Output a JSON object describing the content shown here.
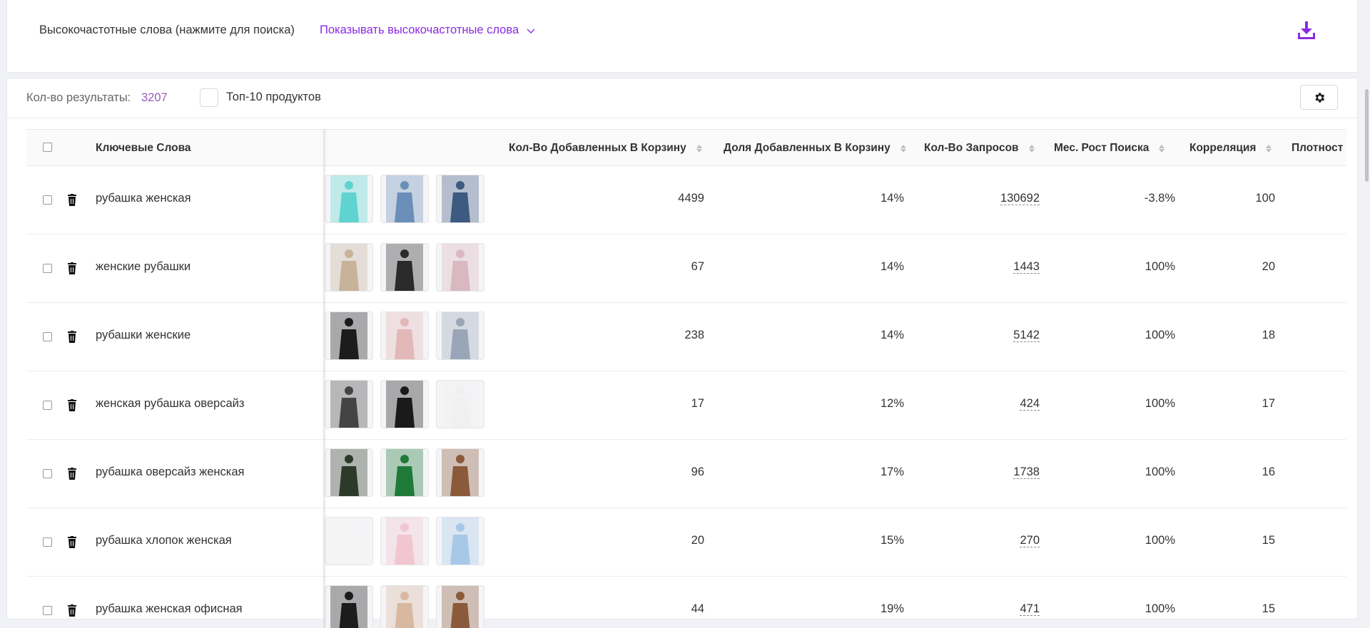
{
  "high_freq": {
    "label": "Высокочастотные слова (нажмите для поиска)",
    "toggle": "Показывать высокочастотные слова",
    "download_icon": "download-icon"
  },
  "results": {
    "count_label": "Кол-во результаты:",
    "count_value": "3207",
    "top10_label": "Топ-10 продуктов",
    "settings_icon": "gear-icon"
  },
  "columns": {
    "keywords": "Ключевые Слова",
    "carts": "Кол-Во Добавленных В Корзину",
    "share": "Доля Добавленных В Корзину",
    "queries": "Кол-Во Запросов",
    "growth": "Мес. Рост Поиска",
    "corr": "Корреляция",
    "density": "Плотност"
  },
  "rows": [
    {
      "keyword": "рубашка женская",
      "carts": "4499",
      "share": "14%",
      "queries": "130692",
      "growth": "-3.8%",
      "corr": "100"
    },
    {
      "keyword": "женские рубашки",
      "carts": "67",
      "share": "14%",
      "queries": "1443",
      "growth": "100%",
      "corr": "20"
    },
    {
      "keyword": "рубашки женские",
      "carts": "238",
      "share": "14%",
      "queries": "5142",
      "growth": "100%",
      "corr": "18"
    },
    {
      "keyword": "женская рубашка оверсайз",
      "carts": "17",
      "share": "12%",
      "queries": "424",
      "growth": "100%",
      "corr": "17"
    },
    {
      "keyword": "рубашка оверсайз женская",
      "carts": "96",
      "share": "17%",
      "queries": "1738",
      "growth": "100%",
      "corr": "16"
    },
    {
      "keyword": "рубашка хлопок женская",
      "carts": "20",
      "share": "15%",
      "queries": "270",
      "growth": "100%",
      "corr": "15"
    },
    {
      "keyword": "рубашка женская офисная",
      "carts": "44",
      "share": "19%",
      "queries": "471",
      "growth": "100%",
      "corr": "15"
    }
  ],
  "colors": {
    "accent": "#8a2be2",
    "count_value": "#9b59b6"
  }
}
